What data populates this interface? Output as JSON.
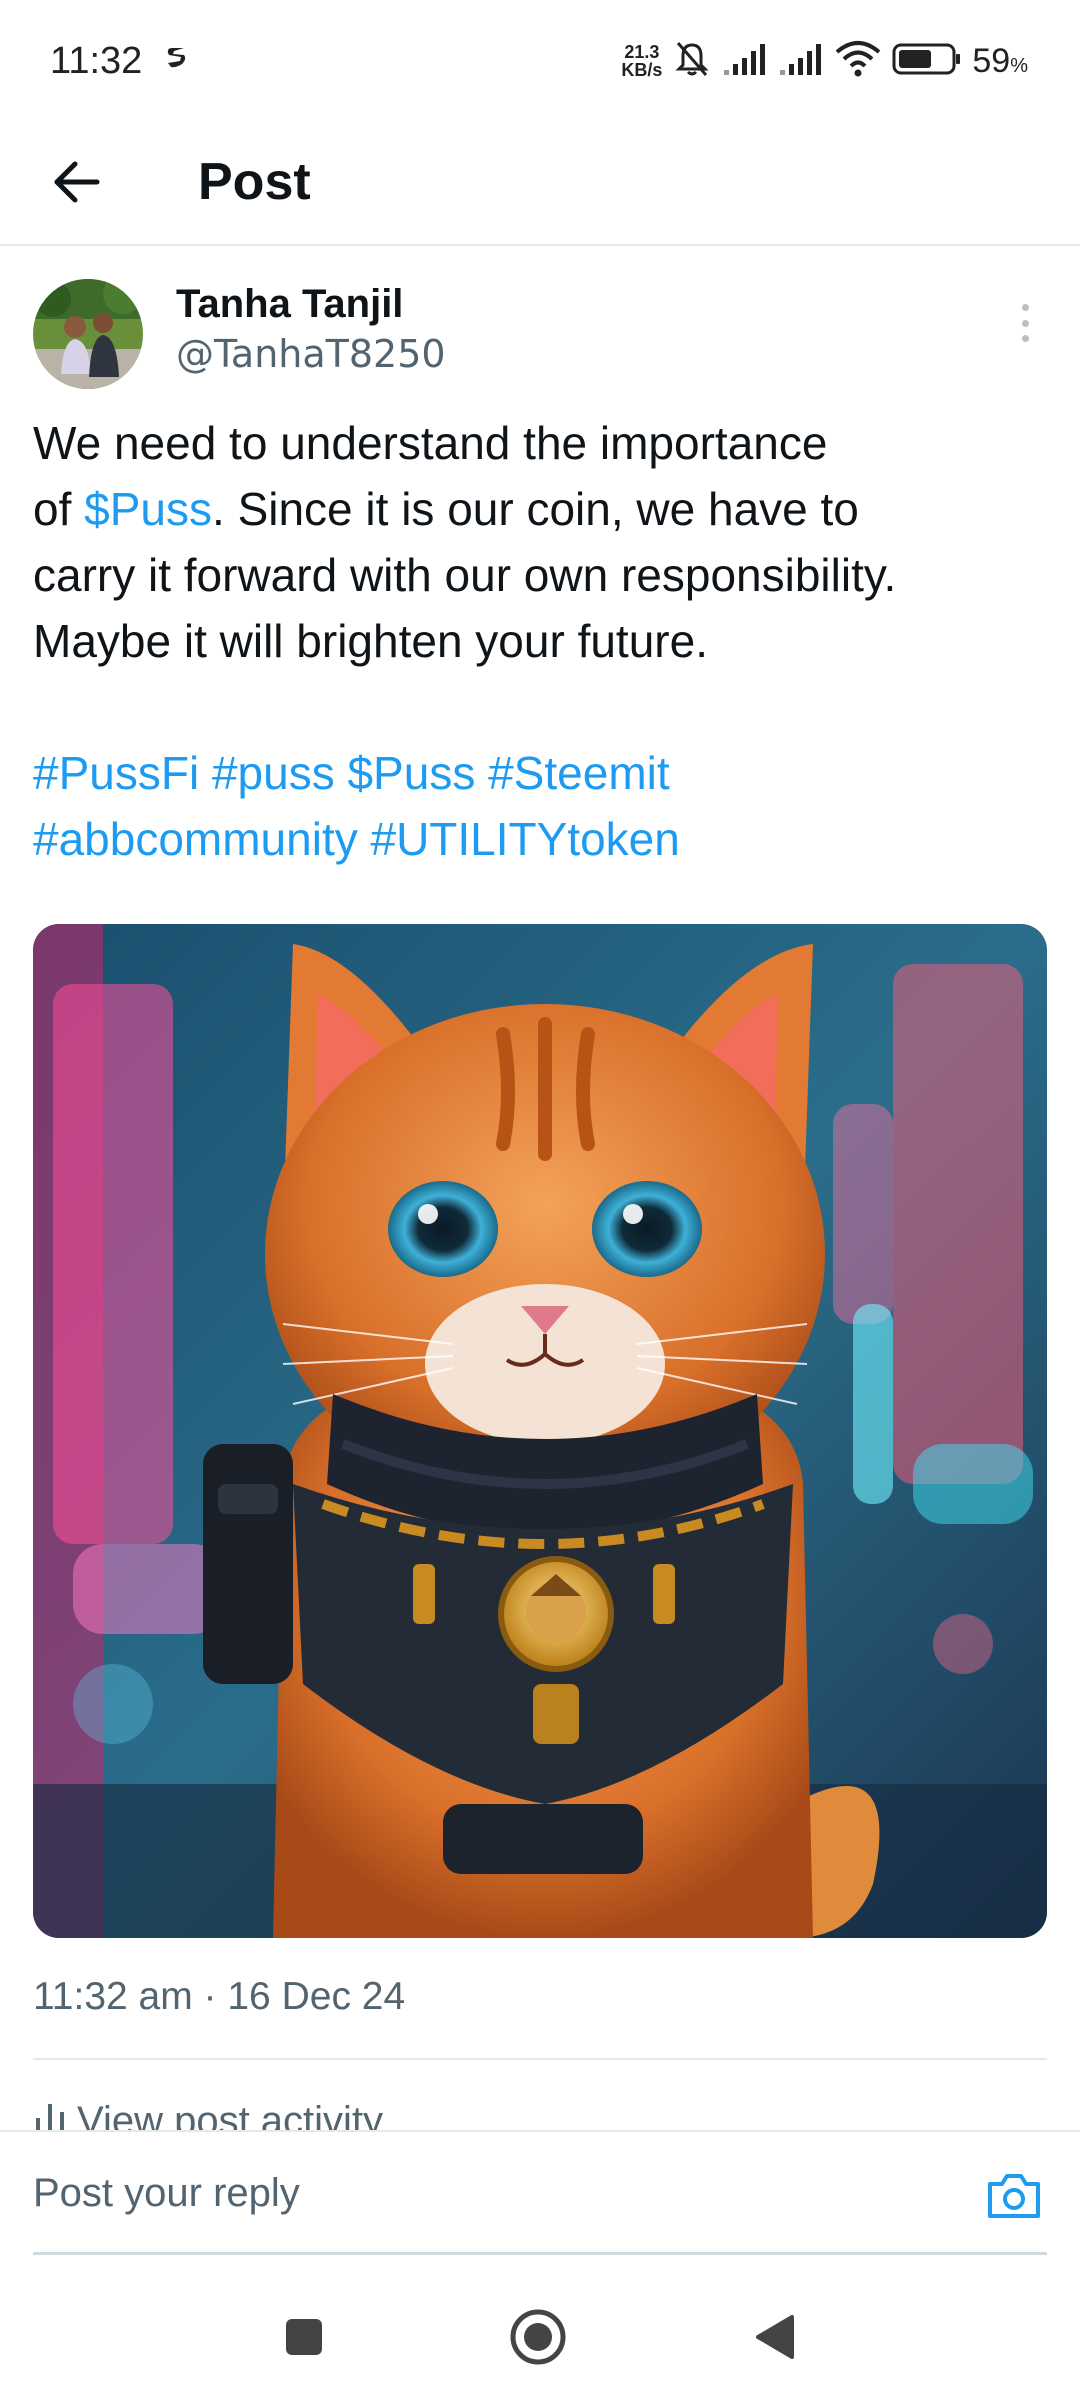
{
  "status_bar": {
    "time": "11:32",
    "net_speed_value": "21.3",
    "net_speed_unit": "KB/s",
    "battery_percent": "59",
    "battery_symbol": "%",
    "icons": [
      "data-saver-icon",
      "mute-bell-icon",
      "signal-icon",
      "signal-icon",
      "wifi-icon",
      "battery-icon"
    ]
  },
  "header": {
    "title": "Post"
  },
  "post": {
    "author_name": "Tanha Tanjil",
    "author_handle": "@TanhaT8250",
    "text_line1": "We need to understand the importance",
    "text_of": "of ",
    "text_link": "$Puss",
    "text_line2_rest": ". Since it is our coin, we have to",
    "text_line3": "carry it forward with our own responsibility.",
    "text_line4": "Maybe it will brighten your future.",
    "hashtags_line1": "#PussFi #puss $Puss #Steemit",
    "hashtags_line2": "#abbcommunity #UTILITYtoken",
    "timestamp": "11:32 am · 16 Dec 24",
    "activity_label": "View post activity"
  },
  "reply": {
    "placeholder": "Post your reply"
  },
  "colors": {
    "link": "#1d9bf0",
    "secondary_text": "#536471",
    "divider": "#e6e9ec"
  }
}
